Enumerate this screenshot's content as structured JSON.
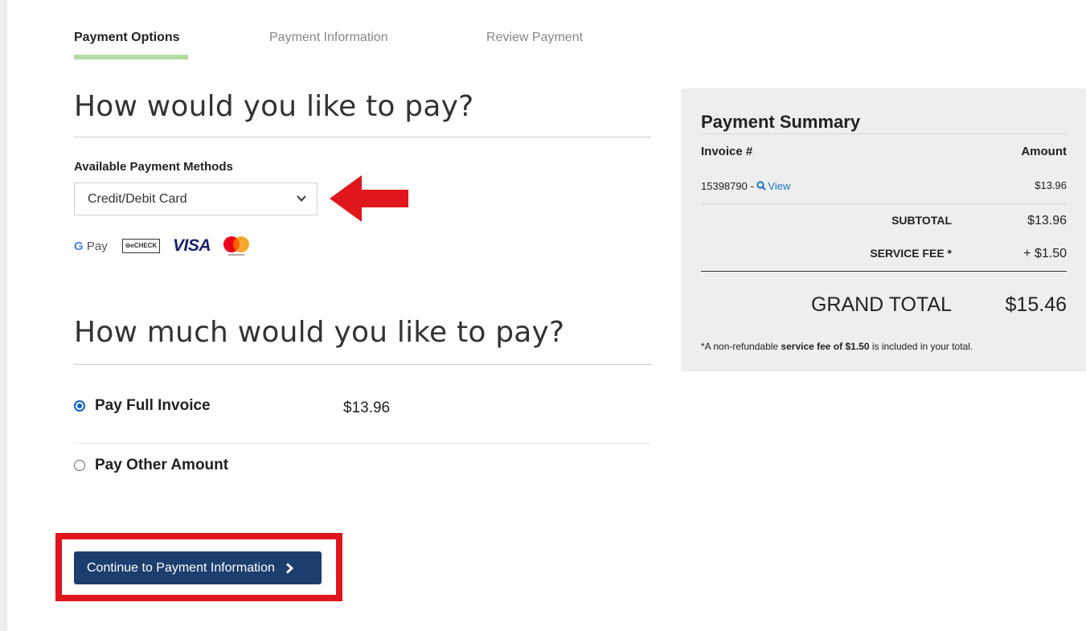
{
  "steps": [
    {
      "label": "Payment Options"
    },
    {
      "label": "Payment Information"
    },
    {
      "label": "Review Payment"
    }
  ],
  "pay_method": {
    "heading": "How would you like to pay?",
    "label": "Available Payment Methods",
    "selected": "Credit/Debit Card",
    "logos": {
      "gpay_g": "G",
      "gpay_text": "Pay",
      "echeck": "⊖eCHECK",
      "visa": "VISA"
    }
  },
  "amount": {
    "heading": "How much would you like to pay?",
    "options": [
      {
        "label": "Pay Full Invoice",
        "value": "$13.96",
        "checked": true
      },
      {
        "label": "Pay Other Amount",
        "checked": false
      }
    ]
  },
  "continue_button": {
    "label": "Continue to Payment Information"
  },
  "summary": {
    "title": "Payment Summary",
    "col_invoice": "Invoice #",
    "col_amount": "Amount",
    "invoice_number": "15398790 - ",
    "view_label": "View",
    "invoice_amount": "$13.96",
    "subtotal_label": "SUBTOTAL",
    "subtotal_value": "$13.96",
    "fee_label": "SERVICE FEE *",
    "fee_value": "+ $1.50",
    "grand_label": "GRAND TOTAL",
    "grand_value": "$15.46",
    "footnote_pre": "*A non-refundable ",
    "footnote_bold": "service fee of $1.50",
    "footnote_post": " is included in your total."
  },
  "colors": {
    "accent_green": "#b3dca0",
    "button_blue": "#1c3e6e",
    "highlight_red": "#e0161d",
    "link_blue": "#1a73c8"
  }
}
